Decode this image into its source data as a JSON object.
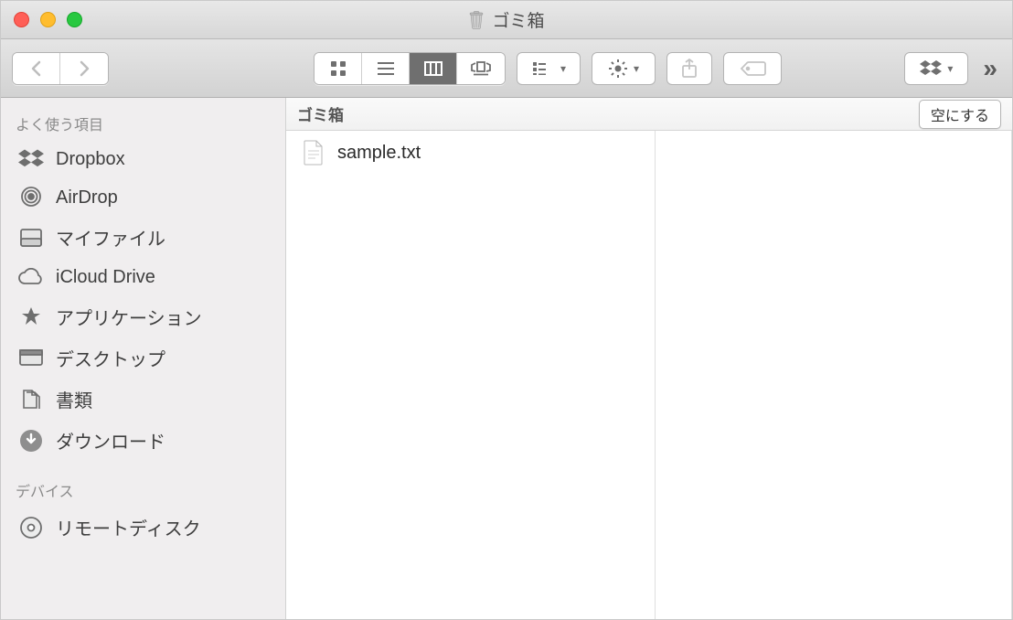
{
  "window": {
    "title": "ゴミ箱"
  },
  "pathbar": {
    "title": "ゴミ箱",
    "empty_label": "空にする"
  },
  "sidebar": {
    "sections": [
      {
        "header": "よく使う項目",
        "items": [
          {
            "icon": "dropbox",
            "label": "Dropbox"
          },
          {
            "icon": "airdrop",
            "label": "AirDrop"
          },
          {
            "icon": "myfiles",
            "label": "マイファイル"
          },
          {
            "icon": "icloud",
            "label": "iCloud Drive"
          },
          {
            "icon": "apps",
            "label": "アプリケーション"
          },
          {
            "icon": "desktop",
            "label": "デスクトップ"
          },
          {
            "icon": "docs",
            "label": "書類"
          },
          {
            "icon": "downloads",
            "label": "ダウンロード"
          }
        ]
      },
      {
        "header": "デバイス",
        "items": [
          {
            "icon": "disc",
            "label": "リモートディスク"
          }
        ]
      }
    ]
  },
  "files": [
    {
      "name": "sample.txt"
    }
  ]
}
